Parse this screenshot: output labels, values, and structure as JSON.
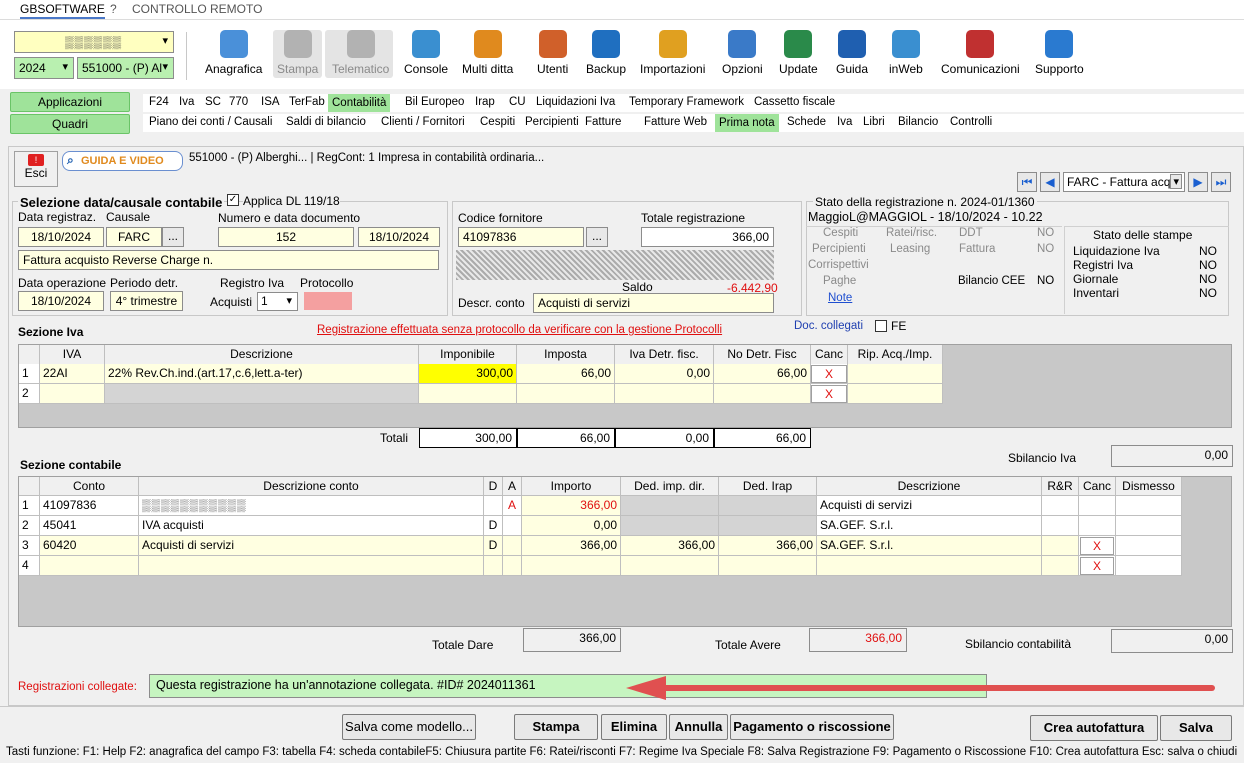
{
  "menubar": {
    "brand": "GBSOFTWARE",
    "help": "?",
    "remote": "CONTROLLO REMOTO"
  },
  "selectors": {
    "company": "▒▒▒▒▒▒",
    "year": "2024",
    "entity": "551000 - (P) Al"
  },
  "toolbar": [
    {
      "label": "Anagrafica",
      "icon": "id-card-icon",
      "color": "#4a90d9",
      "enabled": true
    },
    {
      "label": "Stampa",
      "icon": "printer-icon",
      "color": "#808080",
      "enabled": false
    },
    {
      "label": "Telematico",
      "icon": "telematic-icon",
      "color": "#808080",
      "enabled": false
    },
    {
      "label": "Console",
      "icon": "console-icon",
      "color": "#3a8fd0",
      "enabled": true
    },
    {
      "label": "Multi ditta",
      "icon": "network-icon",
      "color": "#e08a1e",
      "enabled": true
    },
    {
      "label": "Utenti",
      "icon": "users-icon",
      "color": "#d0602a",
      "enabled": true
    },
    {
      "label": "Backup",
      "icon": "backup-icon",
      "color": "#1f6fc0",
      "enabled": true
    },
    {
      "label": "Importazioni",
      "icon": "import-icon",
      "color": "#e0a020",
      "enabled": true
    },
    {
      "label": "Opzioni",
      "icon": "gear-icon",
      "color": "#3a7ac8",
      "enabled": true
    },
    {
      "label": "Update",
      "icon": "update-icon",
      "color": "#2a8a4a",
      "enabled": true
    },
    {
      "label": "Guida",
      "icon": "help-icon",
      "color": "#1f5fb0",
      "enabled": true
    },
    {
      "label": "inWeb",
      "icon": "cloud-icon",
      "color": "#3a8fd0",
      "enabled": true
    },
    {
      "label": "Comunicazioni",
      "icon": "megaphone-icon",
      "color": "#c03030",
      "enabled": true
    },
    {
      "label": "Supporto",
      "icon": "support-icon",
      "color": "#2a7ad0",
      "enabled": true
    }
  ],
  "side": {
    "applicazioni": "Applicazioni",
    "quadri": "Quadri"
  },
  "nav1": [
    "F24",
    "Iva",
    "SC",
    "770",
    "ISA",
    "TerFab",
    "Contabilità",
    "Bil Europeo",
    "Irap",
    "CU",
    "Liquidazioni Iva",
    "Temporary Framework",
    "Cassetto fiscale"
  ],
  "nav2": [
    "Piano dei conti / Causali",
    "Saldi di bilancio",
    "Clienti / Fornitori",
    "Cespiti",
    "Percipienti",
    "Fatture",
    "Fatture Web",
    "Prima nota",
    "Schede",
    "Iva",
    "Libri",
    "Bilancio",
    "Controlli"
  ],
  "header": {
    "esci": "Esci",
    "guida": "GUIDA E VIDEO",
    "info": "551000 - (P) Alberghi... | RegCont: 1 Impresa  in contabilità ordinaria...",
    "causale_select": "FARC - Fattura acq"
  },
  "selection": {
    "title": "Selezione data/causale contabile",
    "applica_label": "Applica DL 119/18",
    "data_reg_label": "Data registraz.",
    "data_reg": "18/10/2024",
    "causale_label": "Causale",
    "causale": "FARC",
    "ellipsis": "...",
    "numdoc_label": "Numero e data documento",
    "numdoc": "152",
    "datadoc": "18/10/2024",
    "descrizione": "Fattura acquisto Reverse Charge n.",
    "data_op_label": "Data operazione",
    "data_op": "18/10/2024",
    "periodo_label": "Periodo detr.",
    "periodo": "4° trimestre",
    "registro_label": "Registro Iva",
    "protocollo_label": "Protocollo",
    "acquisti_label": "Acquisti",
    "acquisti_val": "1"
  },
  "supplier": {
    "codice_label": "Codice fornitore",
    "codice": "41097836",
    "totale_label": "Totale registrazione",
    "totale": "366,00",
    "saldo_label": "Saldo",
    "saldo": "-6.442,90",
    "descr_label": "Descr. conto",
    "descr": "Acquisti di servizi"
  },
  "status": {
    "title": "Stato della registrazione n. 2024-01/1360",
    "user": "MaggioL@MAGGIOL - 18/10/2024 - 10.22",
    "cells": {
      "cespiti": "Cespiti",
      "ratei": "Ratei/risc.",
      "ddt": "DDT",
      "no1": "NO",
      "percipienti": "Percipienti",
      "leasing": "Leasing",
      "fattura": "Fattura",
      "no2": "NO",
      "corrispettivi": "Corrispettivi",
      "paghe": "Paghe",
      "bilancio": "Bilancio CEE",
      "no3": "NO",
      "note": "Note"
    },
    "stampe_title": "Stato delle stampe",
    "stampe": [
      {
        "label": "Liquidazione Iva",
        "value": "NO"
      },
      {
        "label": "Registri Iva",
        "value": "NO"
      },
      {
        "label": "Giornale",
        "value": "NO"
      },
      {
        "label": "Inventari",
        "value": "NO"
      }
    ]
  },
  "iva": {
    "title": "Sezione Iva",
    "warning": "Registrazione effettuata senza protocollo da verificare con la gestione Protocolli",
    "doc_collegati": "Doc. collegati",
    "fe": "FE",
    "headers": [
      "IVA",
      "Descrizione",
      "Imponibile",
      "Imposta",
      "Iva Detr. fisc.",
      "No Detr. Fisc",
      "Canc",
      "Rip. Acq./Imp."
    ],
    "rows": [
      {
        "n": "1",
        "iva": "22AI",
        "descr": "22% Rev.Ch.ind.(art.17,c.6,lett.a-ter)",
        "imponibile": "300,00",
        "imposta": "66,00",
        "detr": "0,00",
        "nodetr": "66,00",
        "canc": "X"
      },
      {
        "n": "2",
        "iva": "",
        "descr": "",
        "imponibile": "",
        "imposta": "",
        "detr": "",
        "nodetr": "",
        "canc": "X"
      }
    ],
    "totali_label": "Totali",
    "totali": {
      "imponibile": "300,00",
      "imposta": "66,00",
      "detr": "0,00",
      "nodetr": "66,00"
    },
    "sbilancio_label": "Sbilancio Iva",
    "sbilancio": "0,00"
  },
  "contabile": {
    "title": "Sezione contabile",
    "headers": [
      "Conto",
      "Descrizione conto",
      "D",
      "A",
      "Importo",
      "Ded. imp. dir.",
      "Ded. Irap",
      "Descrizione",
      "R&R",
      "Canc",
      "Dismesso"
    ],
    "rows": [
      {
        "n": "1",
        "conto": "41097836",
        "descr": "▒▒▒▒▒▒▒▒▒▒▒",
        "d": "",
        "a": "A",
        "importo": "366,00",
        "ded": "",
        "irap": "",
        "descrizione": "Acquisti di servizi",
        "canc": ""
      },
      {
        "n": "2",
        "conto": "45041",
        "descr": "IVA acquisti",
        "d": "D",
        "a": "",
        "importo": "0,00",
        "ded": "",
        "irap": "",
        "descrizione": "SA.GEF. S.r.l.",
        "canc": ""
      },
      {
        "n": "3",
        "conto": "60420",
        "descr": "Acquisti di servizi",
        "d": "D",
        "a": "",
        "importo": "366,00",
        "ded": "366,00",
        "irap": "366,00",
        "descrizione": "SA.GEF. S.r.l.",
        "canc": "X"
      },
      {
        "n": "4",
        "conto": "",
        "descr": "",
        "d": "",
        "a": "",
        "importo": "",
        "ded": "",
        "irap": "",
        "descrizione": "",
        "canc": "X"
      }
    ],
    "totale_dare_label": "Totale Dare",
    "totale_dare": "366,00",
    "totale_avere_label": "Totale Avere",
    "totale_avere": "366,00",
    "sbilancio_label": "Sbilancio contabilità",
    "sbilancio": "0,00"
  },
  "collegate": {
    "label": "Registrazioni collegate:",
    "value": "Questa registrazione ha un'annotazione collegata. #ID# 2024011361"
  },
  "buttons": {
    "salva_modello": "Salva come modello...",
    "stampa": "Stampa",
    "elimina": "Elimina",
    "annulla": "Annulla",
    "pagamento": "Pagamento o riscossione",
    "autofattura": "Crea autofattura",
    "salva": "Salva"
  },
  "footer": "Tasti funzione: F1: Help  F2: anagrafica del campo  F3: tabella  F4: scheda contabileF5: Chiusura partite  F6: Ratei/risconti  F7: Regime Iva Speciale  F8: Salva Registrazione   F9: Pagamento o Riscossione  F10: Crea autofattura   Esc: salva o chiudi",
  "colors": {
    "accent_green": "#9fe39a",
    "field_yellow": "#ffffe1",
    "highlight": "#ffff00",
    "arrow_red": "#e05050",
    "warning_red": "#e01010"
  }
}
